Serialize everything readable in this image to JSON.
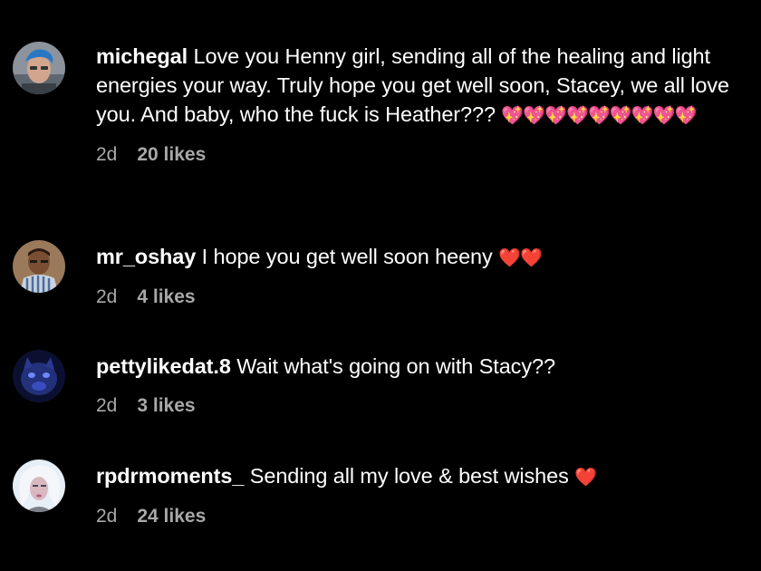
{
  "comments": [
    {
      "username": "michegal",
      "text": " Love you Henny girl, sending all of the healing and light energies your way. Truly hope you get well soon, Stacey, we all love you. And baby, who the fuck is Heather??? ",
      "emoji": "💖💖💖💖💖💖💖💖💖",
      "time": "2d",
      "likes": "20 likes",
      "avatar_colors": [
        "#7a8a9a",
        "#c9a38a",
        "#2d6fb0"
      ]
    },
    {
      "username": "mr_oshay",
      "text": " I hope you get well soon heeny ",
      "emoji": "❤️❤️",
      "time": "2d",
      "likes": "4 likes",
      "avatar_colors": [
        "#b07a4f",
        "#5b3a28",
        "#c0c8d4"
      ]
    },
    {
      "username": "pettylikedat.8",
      "text": " Wait what's going on with Stacy??",
      "emoji": "",
      "time": "2d",
      "likes": "3 likes",
      "avatar_colors": [
        "#1a1f4a",
        "#3b4cc0",
        "#0a0d22"
      ]
    },
    {
      "username": "rpdrmoments_",
      "text": " Sending all my love & best wishes ",
      "emoji": "❤️",
      "time": "2d",
      "likes": "24 likes",
      "avatar_colors": [
        "#dfe8f2",
        "#c8a8b8",
        "#6a6f7a"
      ]
    }
  ],
  "colors": {
    "background": "#000000",
    "text": "#ffffff",
    "meta": "#a8a8a8"
  }
}
